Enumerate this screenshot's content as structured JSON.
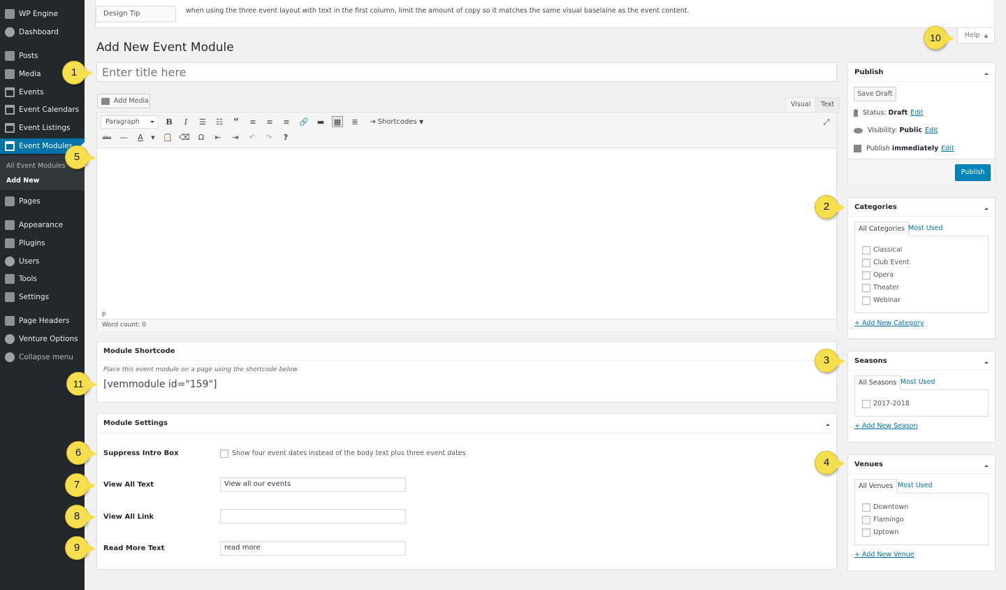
{
  "sidebar": {
    "items": [
      {
        "label": "WP Engine",
        "icon": "wpengine-icon"
      },
      {
        "label": "Dashboard",
        "icon": "dashboard-icon"
      },
      {
        "label": "Posts",
        "icon": "pin-icon"
      },
      {
        "label": "Media",
        "icon": "media-icon"
      },
      {
        "label": "Events",
        "icon": "calendar-icon"
      },
      {
        "label": "Event Calendars",
        "icon": "calendar-icon"
      },
      {
        "label": "Event Listings",
        "icon": "calendar-icon"
      },
      {
        "label": "Event Modules",
        "icon": "calendar-icon"
      },
      {
        "label": "Pages",
        "icon": "pages-icon"
      },
      {
        "label": "Appearance",
        "icon": "brush-icon"
      },
      {
        "label": "Plugins",
        "icon": "plugin-icon"
      },
      {
        "label": "Users",
        "icon": "user-icon"
      },
      {
        "label": "Tools",
        "icon": "wrench-icon"
      },
      {
        "label": "Settings",
        "icon": "settings-icon"
      },
      {
        "label": "Page Headers",
        "icon": "page-headers-icon"
      },
      {
        "label": "Venture Options",
        "icon": "gear-icon"
      },
      {
        "label": "Collapse menu",
        "icon": "collapse-icon"
      }
    ],
    "submenu": [
      "All Event Modules",
      "Add New"
    ]
  },
  "notice": {
    "tab": "Design Tip",
    "text": "when using the three event layout with text in the first column, limit the amount of copy so it matches the same visual baselaine as the event content."
  },
  "help_label": "Help",
  "page_title": "Add New Event Module",
  "title_placeholder": "Enter title here",
  "editor": {
    "add_media": "Add Media",
    "tab_visual": "Visual",
    "tab_text": "Text",
    "format": "Paragraph",
    "shortcodes": "Shortcodes",
    "path": "p",
    "word_count": "Word count: 0"
  },
  "shortcode_box": {
    "title": "Module Shortcode",
    "description": "Place this event module on a page using the shortcode below",
    "code": "[vemmodule id=\"159\"]"
  },
  "settings_box": {
    "title": "Module Settings",
    "suppress_label": "Suppress Intro Box",
    "suppress_text": "Show four event dates instead of the body text plus three event dates",
    "view_all_text_label": "View All Text",
    "view_all_text_value": "View all our events",
    "view_all_link_label": "View All Link",
    "view_all_link_value": "",
    "read_more_label": "Read More Text",
    "read_more_value": "read more"
  },
  "publish": {
    "title": "Publish",
    "save_draft": "Save Draft",
    "status_label": "Status:",
    "status_value": "Draft",
    "visibility_label": "Visibility:",
    "visibility_value": "Public",
    "publish_label": "Publish",
    "publish_value": "immediately",
    "edit": "Edit",
    "publish_button": "Publish"
  },
  "categories": {
    "title": "Categories",
    "tab_all": "All Categories",
    "tab_most": "Most Used",
    "items": [
      "Classical",
      "Club Event",
      "Opera",
      "Theater",
      "Webinar"
    ],
    "add_new": "+ Add New Category"
  },
  "seasons": {
    "title": "Seasons",
    "tab_all": "All Seasons",
    "tab_most": "Most Used",
    "items": [
      "2017-2018"
    ],
    "add_new": "+ Add New Season"
  },
  "venues": {
    "title": "Venues",
    "tab_all": "All Venues",
    "tab_most": "Most Used",
    "items": [
      "Downtown",
      "Flamingo",
      "Uptown"
    ],
    "add_new": "+ Add New Venue"
  },
  "callouts": [
    "1",
    "2",
    "3",
    "4",
    "5",
    "6",
    "7",
    "8",
    "9",
    "10",
    "11"
  ],
  "colors": {
    "sidebar_bg": "#23282d",
    "active_blue": "#0073aa",
    "callout_yellow": "#f6df4c",
    "publish_button": "#0085ba"
  }
}
